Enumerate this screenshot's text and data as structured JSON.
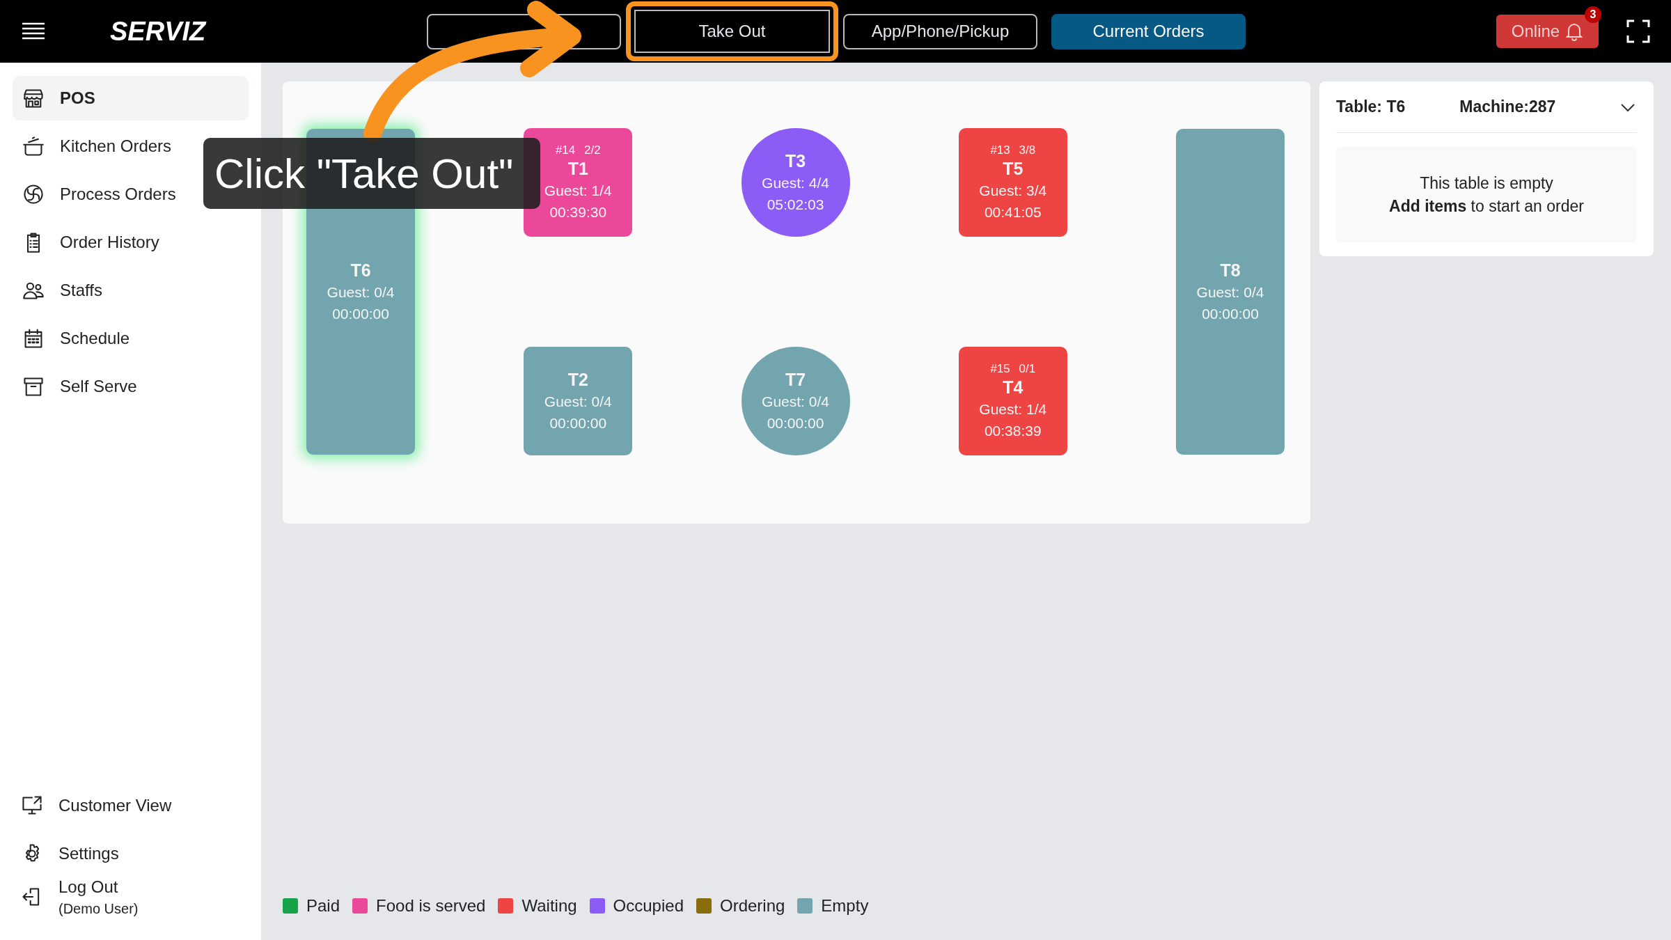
{
  "app": {
    "name": "SERVIZ"
  },
  "order_buttons": [
    {
      "label": "Take Out",
      "kind": "outline",
      "highlighted": true
    },
    {
      "label": "App/Phone/Pickup",
      "kind": "outline",
      "highlighted": false
    },
    {
      "label": "Current Orders",
      "kind": "primary",
      "highlighted": false
    }
  ],
  "status": {
    "label": "Online",
    "notifications": "3"
  },
  "sidebar": {
    "items": [
      {
        "label": "POS",
        "selected": true
      },
      {
        "label": "Kitchen Orders",
        "selected": false
      },
      {
        "label": "Process Orders",
        "selected": false
      },
      {
        "label": "Order History",
        "selected": false
      },
      {
        "label": "Staffs",
        "selected": false
      },
      {
        "label": "Schedule",
        "selected": false
      },
      {
        "label": "Self Serve",
        "selected": false
      }
    ],
    "bottom_items": [
      {
        "label": "Customer View"
      },
      {
        "label": "Settings"
      },
      {
        "label": "Log Out",
        "note": "(Demo User)"
      }
    ]
  },
  "tables": [
    {
      "name": "T6",
      "kind": "tall",
      "color": "#72a5ae",
      "guests": "Guest: 0/4",
      "time": "00:00:00",
      "selected": true
    },
    {
      "name": "T1",
      "kind": "square",
      "color": "#ec4899",
      "order": "#14",
      "items": "2/2",
      "guests": "Guest: 1/4",
      "time": "00:39:30",
      "selected": false
    },
    {
      "name": "T3",
      "kind": "circle",
      "color": "#8b5cf6",
      "guests": "Guest: 4/4",
      "time": "05:02:03",
      "selected": false
    },
    {
      "name": "T5",
      "kind": "square",
      "color": "#ef4444",
      "order": "#13",
      "items": "3/8",
      "guests": "Guest: 3/4",
      "time": "00:41:05",
      "selected": false
    },
    {
      "name": "T8",
      "kind": "tall",
      "color": "#72a5ae",
      "guests": "Guest: 0/4",
      "time": "00:00:00",
      "selected": false
    },
    {
      "name": "T2",
      "kind": "square",
      "color": "#72a5ae",
      "guests": "Guest: 0/4",
      "time": "00:00:00",
      "selected": false
    },
    {
      "name": "T7",
      "kind": "circle",
      "color": "#72a5ae",
      "guests": "Guest: 0/4",
      "time": "00:00:00",
      "selected": false
    },
    {
      "name": "T4",
      "kind": "square",
      "color": "#ef4444",
      "order": "#15",
      "items": "0/1",
      "guests": "Guest: 1/4",
      "time": "00:38:39",
      "selected": false
    }
  ],
  "order_panel": {
    "table": "Table: T6",
    "machine": "Machine:287",
    "expanded": false,
    "message": "This table is empty",
    "hint": "**Add items** to start an order"
  },
  "legend": [
    {
      "label": "Paid",
      "color": "#16a34a"
    },
    {
      "label": "Food is served",
      "color": "#ec4899"
    },
    {
      "label": "Waiting",
      "color": "#ef4444"
    },
    {
      "label": "Occupied",
      "color": "#8b5cf6"
    },
    {
      "label": "Ordering",
      "color": "#8a6d0b"
    },
    {
      "label": "Empty",
      "color": "#72a5ae"
    }
  ],
  "tutorial": {
    "text": "Click \"Take Out\""
  }
}
